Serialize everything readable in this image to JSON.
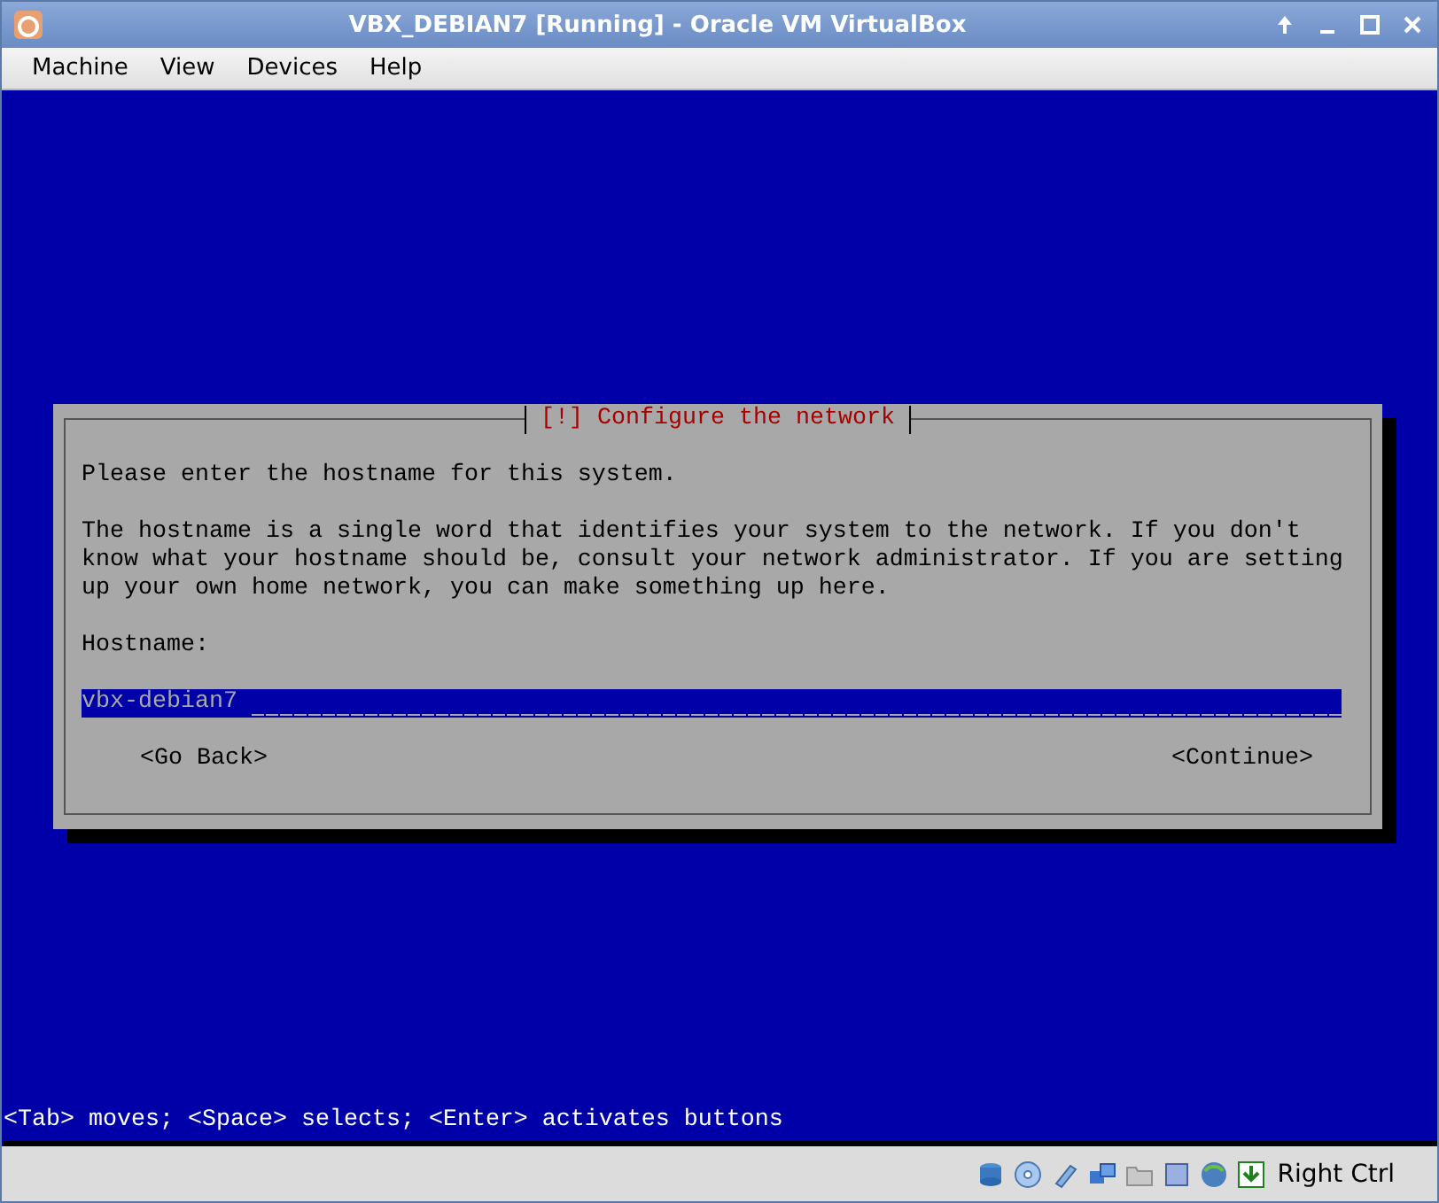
{
  "window": {
    "title": "VBX_DEBIAN7 [Running] - Oracle VM VirtualBox"
  },
  "menu": [
    "Machine",
    "View",
    "Devices",
    "Help"
  ],
  "dialog": {
    "title": "[!] Configure the network",
    "paragraphs": [
      "Please enter the hostname for this system.",
      "The hostname is a single word that identifies your system to the network. If you don't know what your hostname should be, consult your network administrator. If you are setting up your own home network, you can make something up here."
    ],
    "field_label": "Hostname:",
    "field": {
      "value": "vbx-debian7"
    },
    "buttons": [
      {
        "label": "<Go Back>",
        "selected": false
      },
      {
        "label": "<Continue>",
        "selected": false
      }
    ]
  },
  "hint": "<Tab> moves; <Space> selects; <Enter> activates buttons",
  "status_bar": {
    "host_key": "Right Ctrl"
  }
}
